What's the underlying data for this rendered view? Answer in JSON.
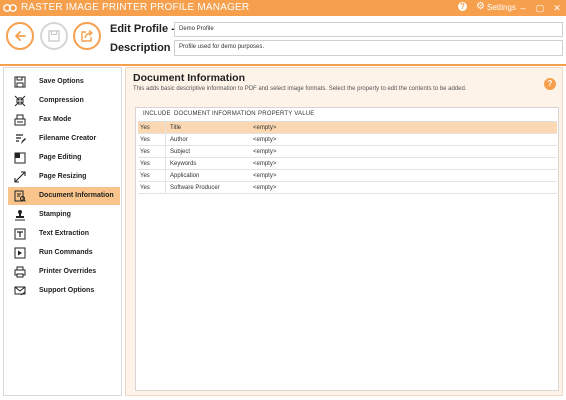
{
  "app": {
    "title": "RASTER IMAGE PRINTER PROFILE MANAGER",
    "settings_label": "Settings",
    "help_glyph": "?"
  },
  "toolbar": {
    "edit_profile_label": "Edit Profile -",
    "description_label": "Description",
    "profile_name": "Demo Profile",
    "profile_description": "Profile used for demo purposes."
  },
  "sidebar": {
    "items": [
      {
        "label": "Save Options",
        "icon": "save-icon"
      },
      {
        "label": "Compression",
        "icon": "compress-icon"
      },
      {
        "label": "Fax Mode",
        "icon": "fax-icon"
      },
      {
        "label": "Filename Creator",
        "icon": "filename-icon"
      },
      {
        "label": "Page Editing",
        "icon": "page-edit-icon"
      },
      {
        "label": "Page Resizing",
        "icon": "resize-icon"
      },
      {
        "label": "Document Information",
        "icon": "document-info-icon",
        "active": true
      },
      {
        "label": "Stamping",
        "icon": "stamp-icon"
      },
      {
        "label": "Text Extraction",
        "icon": "text-extract-icon"
      },
      {
        "label": "Run Commands",
        "icon": "run-icon"
      },
      {
        "label": "Printer Overrides",
        "icon": "printer-icon"
      },
      {
        "label": "Support Options",
        "icon": "support-icon"
      }
    ]
  },
  "main": {
    "heading": "Document Information",
    "description": "This adds basic descriptive information to PDF and select image formats. Select the property to edit the contents to be added.",
    "help_glyph": "?",
    "table": {
      "headers": [
        "INCLUDE",
        "DOCUMENT INFORMATION",
        "PROPERTY VALUE"
      ],
      "rows": [
        {
          "include": "Yes",
          "info": "Title",
          "value": "<empty>",
          "selected": true
        },
        {
          "include": "Yes",
          "info": "Author",
          "value": "<empty>"
        },
        {
          "include": "Yes",
          "info": "Subject",
          "value": "<empty>"
        },
        {
          "include": "Yes",
          "info": "Keywords",
          "value": "<empty>"
        },
        {
          "include": "Yes",
          "info": "Application",
          "value": "<empty>"
        },
        {
          "include": "Yes",
          "info": "Software Producer",
          "value": "<empty>"
        }
      ]
    }
  },
  "colors": {
    "accent": "#f6a04d",
    "selected_row": "#fbd7b2",
    "active_nav": "#f8c48c",
    "panel_bg": "#fdf3e9"
  }
}
